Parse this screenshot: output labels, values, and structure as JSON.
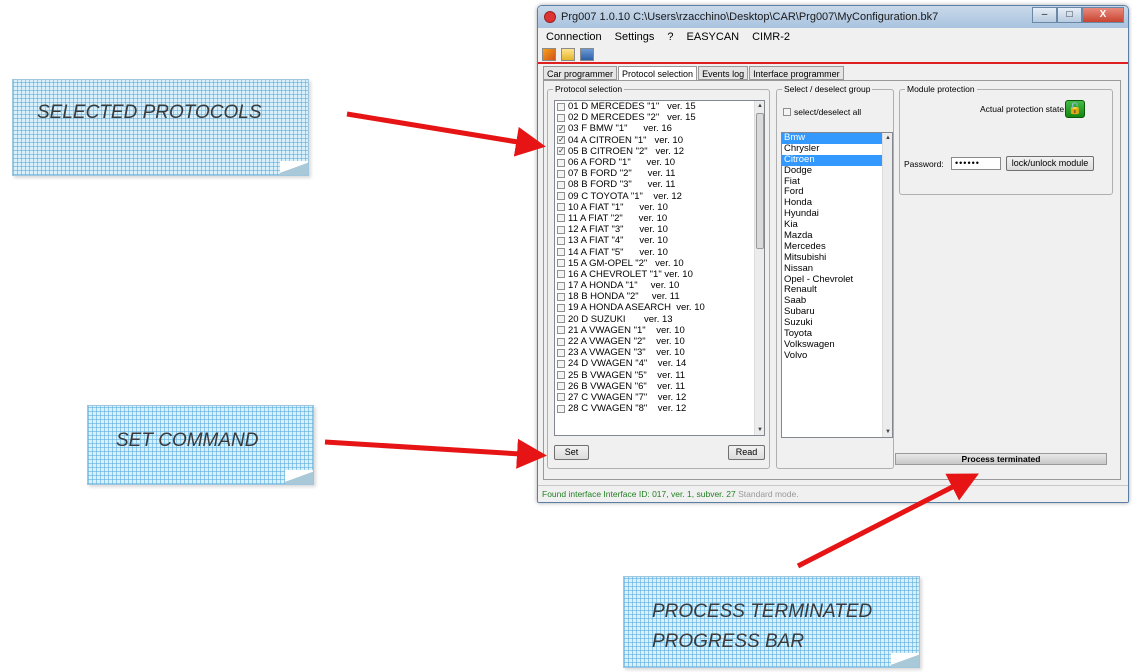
{
  "callouts": {
    "selected_protocols": "SELECTED PROTOCOLS",
    "set_command": "SET COMMAND",
    "process_line1": "PROCESS TERMINATED",
    "process_line2": "PROGRESS BAR"
  },
  "window": {
    "title": "Prg007  1.0.10  C:\\Users\\rzacchino\\Desktop\\CAR\\Prg007\\MyConfiguration.bk7",
    "close_label": "X"
  },
  "menu": [
    "Connection",
    "Settings",
    "?",
    "EASYCAN",
    "CIMR-2"
  ],
  "tabs": [
    "Car programmer",
    "Protocol selection",
    "Events log",
    "Interface programmer"
  ],
  "protocol_selection": {
    "legend": "Protocol selection",
    "items": [
      {
        "label": "01 D MERCEDES \"1\"   ver. 15",
        "checked": false
      },
      {
        "label": "02 D MERCEDES \"2\"   ver. 15",
        "checked": false
      },
      {
        "label": "03 F BMW \"1\"      ver. 16",
        "checked": true
      },
      {
        "label": "04 A CITROEN \"1\"   ver. 10",
        "checked": true
      },
      {
        "label": "05 B CITROEN \"2\"   ver. 12",
        "checked": true
      },
      {
        "label": "06 A FORD \"1\"      ver. 10",
        "checked": false
      },
      {
        "label": "07 B FORD \"2\"      ver. 11",
        "checked": false
      },
      {
        "label": "08 B FORD \"3\"      ver. 11",
        "checked": false
      },
      {
        "label": "09 C TOYOTA \"1\"    ver. 12",
        "checked": false
      },
      {
        "label": "10 A FIAT \"1\"      ver. 10",
        "checked": false
      },
      {
        "label": "11 A FIAT \"2\"      ver. 10",
        "checked": false
      },
      {
        "label": "12 A FIAT \"3\"      ver. 10",
        "checked": false
      },
      {
        "label": "13 A FIAT \"4\"      ver. 10",
        "checked": false
      },
      {
        "label": "14 A FIAT \"5\"      ver. 10",
        "checked": false
      },
      {
        "label": "15 A GM-OPEL \"2\"   ver. 10",
        "checked": false
      },
      {
        "label": "16 A CHEVROLET \"1\" ver. 10",
        "checked": false
      },
      {
        "label": "17 A HONDA \"1\"     ver. 10",
        "checked": false
      },
      {
        "label": "18 B HONDA \"2\"     ver. 11",
        "checked": false
      },
      {
        "label": "19 A HONDA ASEARCH  ver. 10",
        "checked": false
      },
      {
        "label": "20 D SUZUKI       ver. 13",
        "checked": false
      },
      {
        "label": "21 A VWAGEN \"1\"    ver. 10",
        "checked": false
      },
      {
        "label": "22 A VWAGEN \"2\"    ver. 10",
        "checked": false
      },
      {
        "label": "23 A VWAGEN \"3\"    ver. 10",
        "checked": false
      },
      {
        "label": "24 D VWAGEN \"4\"    ver. 14",
        "checked": false
      },
      {
        "label": "25 B VWAGEN \"5\"    ver. 11",
        "checked": false
      },
      {
        "label": "26 B VWAGEN \"6\"    ver. 11",
        "checked": false
      },
      {
        "label": "27 C VWAGEN \"7\"    ver. 12",
        "checked": false
      },
      {
        "label": "28 C VWAGEN \"8\"    ver. 12",
        "checked": false
      }
    ],
    "set_label": "Set",
    "read_label": "Read"
  },
  "group": {
    "legend": "Select / deselect group",
    "select_all": "select/deselect all",
    "items": [
      "Bmw",
      "Chrysler",
      "Citroen",
      "Dodge",
      "Fiat",
      "Ford",
      "Honda",
      "Hyundai",
      "Kia",
      "Mazda",
      "Mercedes",
      "Mitsubishi",
      "Nissan",
      "Opel - Chevrolet",
      "Renault",
      "Saab",
      "Subaru",
      "Suzuki",
      "Toyota",
      "Volkswagen",
      "Volvo"
    ],
    "selected": [
      "Bmw",
      "Citroen"
    ]
  },
  "module": {
    "legend": "Module protection",
    "state_label": "Actual protection state:",
    "password_label": "Password:",
    "password_value": "••••••",
    "lock_button": "lock/unlock module"
  },
  "progress_text": "Process terminated",
  "status": {
    "found": "Found interface  Interface ID: 017, ver. 1, subver. 27",
    "mode": "Standard mode."
  },
  "colors": {
    "accent_red": "#e02020",
    "selection_blue": "#3399ff",
    "status_green": "#238023",
    "note_blue": "#d9eff9"
  }
}
